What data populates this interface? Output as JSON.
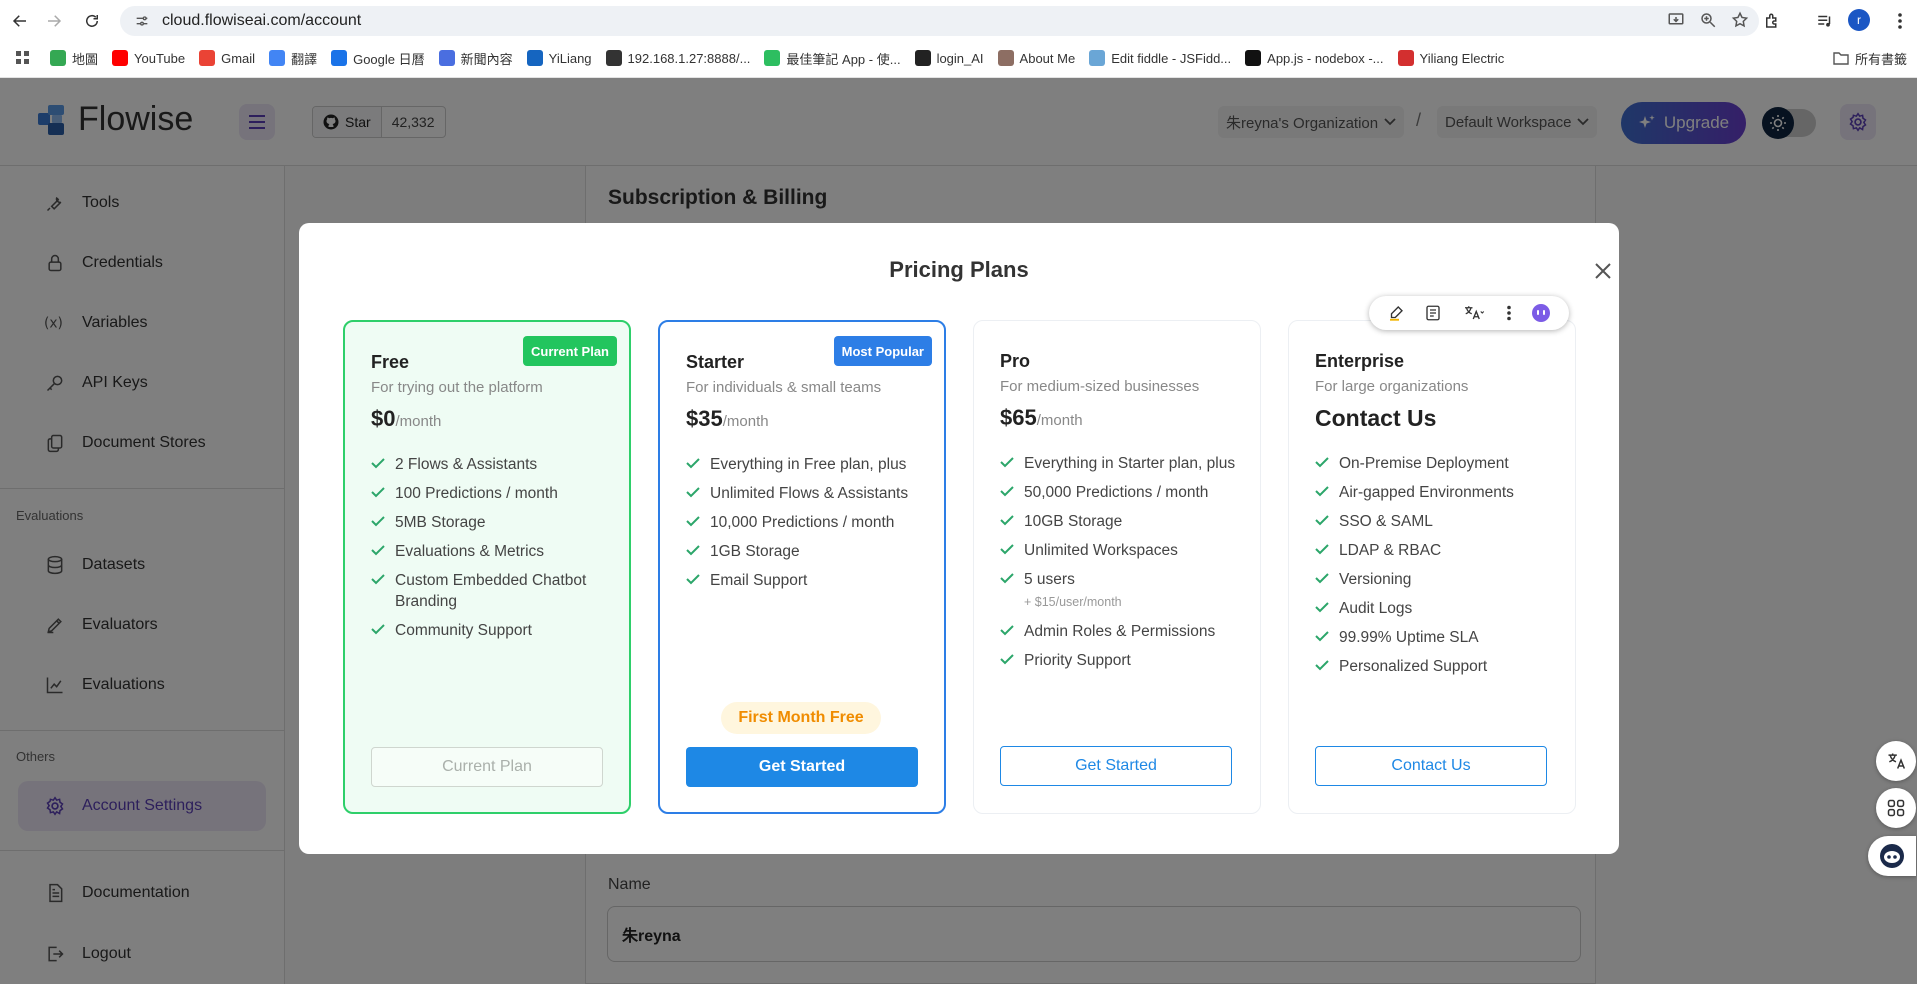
{
  "browser": {
    "url": "cloud.flowiseai.com/account",
    "profile_initial": "r",
    "bookmarks": [
      {
        "label": "地圖",
        "color": "#34a853"
      },
      {
        "label": "YouTube",
        "color": "#ff0000"
      },
      {
        "label": "Gmail",
        "color": "#ea4335"
      },
      {
        "label": "翻譯",
        "color": "#4285f4"
      },
      {
        "label": "Google 日曆",
        "color": "#1a73e8"
      },
      {
        "label": "新聞內容",
        "color": "#4a6ee0"
      },
      {
        "label": "YiLiang",
        "color": "#1565c0"
      },
      {
        "label": "192.168.1.27:8888/...",
        "color": "#333333"
      },
      {
        "label": "最佳筆記 App - 使...",
        "color": "#2dbe60"
      },
      {
        "label": "login_AI",
        "color": "#222222"
      },
      {
        "label": "About Me",
        "color": "#8d6e63"
      },
      {
        "label": "Edit fiddle - JSFidd...",
        "color": "#6aa6d6"
      },
      {
        "label": "App.js - nodebox -...",
        "color": "#111111"
      },
      {
        "label": "Yiliang Electric",
        "color": "#d32f2f"
      }
    ],
    "all_bookmarks": "所有書籤"
  },
  "header": {
    "logo_text": "Flowise",
    "star_label": "Star",
    "star_count": "42,332",
    "org": "朱reyna's Organization",
    "separator": "/",
    "workspace": "Default Workspace",
    "upgrade_label": "Upgrade"
  },
  "sidebar": {
    "items_top": [
      {
        "label": "Tools",
        "icon": "tool-icon"
      },
      {
        "label": "Credentials",
        "icon": "lock-icon"
      },
      {
        "label": "Variables",
        "icon": "variable-icon"
      },
      {
        "label": "API Keys",
        "icon": "key-icon"
      },
      {
        "label": "Document Stores",
        "icon": "files-icon"
      }
    ],
    "section_evaluations": "Evaluations",
    "items_eval": [
      {
        "label": "Datasets",
        "icon": "database-icon"
      },
      {
        "label": "Evaluators",
        "icon": "pen-icon"
      },
      {
        "label": "Evaluations",
        "icon": "chart-icon"
      }
    ],
    "section_others": "Others",
    "account_settings": "Account Settings",
    "documentation": "Documentation",
    "logout": "Logout"
  },
  "page": {
    "subscription_title": "Subscription & Billing",
    "name_label": "Name",
    "name_value": "朱reyna"
  },
  "modal": {
    "title": "Pricing Plans",
    "plans": [
      {
        "name": "Free",
        "badge": "Current Plan",
        "badge_color": "#22c55e",
        "desc": "For trying out the platform",
        "price": "$0",
        "per": "/month",
        "features": [
          "2 Flows & Assistants",
          "100 Predictions / month",
          "5MB Storage",
          "Evaluations & Metrics",
          "Custom Embedded Chatbot Branding",
          "Community Support"
        ],
        "button": "Current Plan"
      },
      {
        "name": "Starter",
        "badge": "Most Popular",
        "badge_color": "#2d7ee6",
        "desc": "For individuals & small teams",
        "price": "$35",
        "per": "/month",
        "features": [
          "Everything in Free plan, plus",
          "Unlimited Flows & Assistants",
          "10,000 Predictions / month",
          "1GB Storage",
          "Email Support"
        ],
        "promo": "First Month Free",
        "button": "Get Started"
      },
      {
        "name": "Pro",
        "desc": "For medium-sized businesses",
        "price": "$65",
        "per": "/month",
        "features": [
          "Everything in Starter plan, plus",
          "50,000 Predictions / month",
          "10GB Storage",
          "Unlimited Workspaces",
          "5 users",
          "Admin Roles & Permissions",
          "Priority Support"
        ],
        "users_note": "+ $15/user/month",
        "button": "Get Started"
      },
      {
        "name": "Enterprise",
        "desc": "For large organizations",
        "price": "Contact Us",
        "features": [
          "On-Premise Deployment",
          "Air-gapped Environments",
          "SSO & SAML",
          "LDAP & RBAC",
          "Versioning",
          "Audit Logs",
          "99.99% Uptime SLA",
          "Personalized Support"
        ],
        "button": "Contact Us"
      }
    ]
  }
}
